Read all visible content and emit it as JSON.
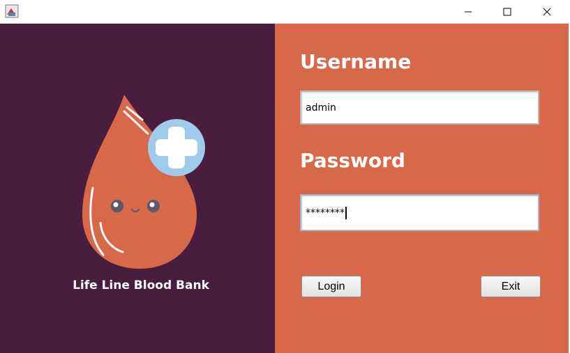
{
  "window": {
    "icon": "java-app-icon",
    "controls": [
      "minimize-icon",
      "maximize-icon",
      "close-icon"
    ]
  },
  "brand": {
    "name": "Life Line Blood Bank",
    "logo": "blood-drop-icon"
  },
  "form": {
    "username_label": "Username",
    "username_value": "admin",
    "password_label": "Password",
    "password_value": "********",
    "login_label": "Login",
    "exit_label": "Exit"
  },
  "colors": {
    "left_panel": "#481d3e",
    "right_panel": "#d8684a",
    "drop": "#d8684a",
    "plus_circle": "#9dcbe9"
  }
}
